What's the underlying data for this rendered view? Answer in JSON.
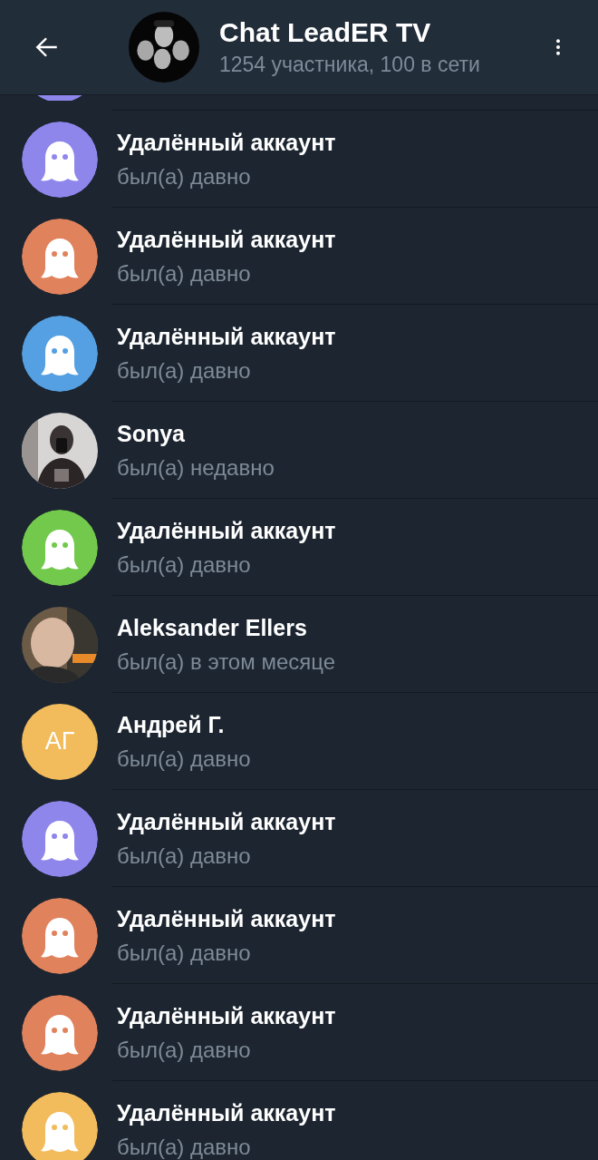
{
  "header": {
    "title": "Chat LeadER TV",
    "subtitle": "1254 участника, 100 в сети"
  },
  "members": [
    {
      "kind": "deleted",
      "color": "#8f86ec"
    },
    {
      "kind": "deleted",
      "color": "#8f86ec",
      "name": "Удалённый аккаунт",
      "status": "был(а) давно"
    },
    {
      "kind": "deleted",
      "color": "#e0825c",
      "name": "Удалённый аккаунт",
      "status": "был(а) давно"
    },
    {
      "kind": "deleted",
      "color": "#55a0e2",
      "name": "Удалённый аккаунт",
      "status": "был(а) давно"
    },
    {
      "name": "Sonya",
      "status": "был(а) недавно"
    },
    {
      "kind": "deleted",
      "color": "#72c94b",
      "name": "Удалённый аккаунт",
      "status": "был(а) давно"
    },
    {
      "name": "Aleksander Ellers",
      "status": "был(а) в этом месяце"
    },
    {
      "kind": "initials",
      "color": "#f2bb5c",
      "initials": "АГ",
      "name": "Андрей Г.",
      "status": "был(а) давно"
    },
    {
      "kind": "deleted",
      "color": "#8f86ec",
      "name": "Удалённый аккаунт",
      "status": "был(а) давно"
    },
    {
      "kind": "deleted",
      "color": "#e0825c",
      "name": "Удалённый аккаунт",
      "status": "был(а) давно"
    },
    {
      "kind": "deleted",
      "color": "#e0825c",
      "name": "Удалённый аккаунт",
      "status": "был(а) давно"
    },
    {
      "kind": "deleted",
      "color": "#f2bb5c",
      "name": "Удалённый аккаунт",
      "status": "был(а) давно"
    }
  ]
}
